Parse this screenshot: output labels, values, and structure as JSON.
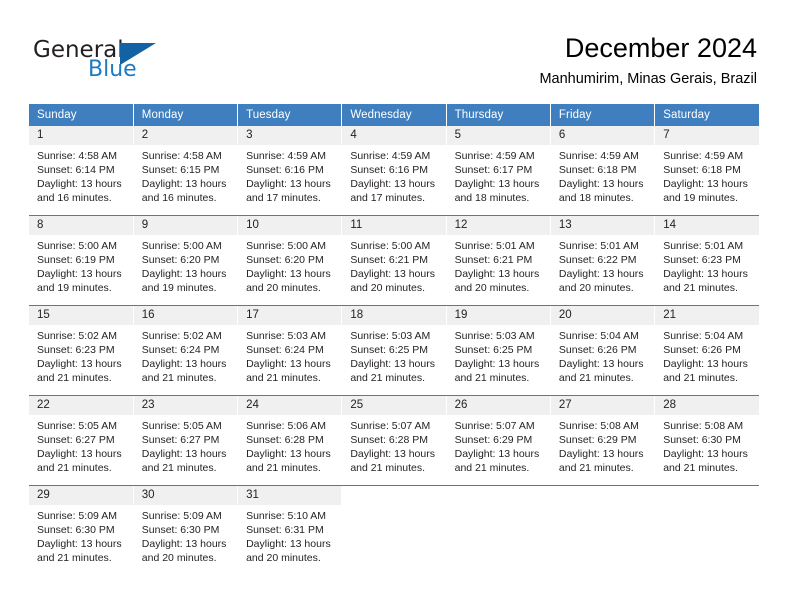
{
  "brand": {
    "name_part1": "General",
    "name_part2": "Blue",
    "triangle_color": "#1362a3",
    "blue_color": "#1f7ac1"
  },
  "header": {
    "title": "December 2024",
    "subtitle": "Manhumirim, Minas Gerais, Brazil"
  },
  "theme": {
    "header_blue": "#3f7fbf",
    "daynum_bg": "#f0f0f0"
  },
  "weekday_headers": [
    "Sunday",
    "Monday",
    "Tuesday",
    "Wednesday",
    "Thursday",
    "Friday",
    "Saturday"
  ],
  "weeks": [
    [
      {
        "day": "1",
        "sunrise": "Sunrise: 4:58 AM",
        "sunset": "Sunset: 6:14 PM",
        "daylight1": "Daylight: 13 hours",
        "daylight2": "and 16 minutes."
      },
      {
        "day": "2",
        "sunrise": "Sunrise: 4:58 AM",
        "sunset": "Sunset: 6:15 PM",
        "daylight1": "Daylight: 13 hours",
        "daylight2": "and 16 minutes."
      },
      {
        "day": "3",
        "sunrise": "Sunrise: 4:59 AM",
        "sunset": "Sunset: 6:16 PM",
        "daylight1": "Daylight: 13 hours",
        "daylight2": "and 17 minutes."
      },
      {
        "day": "4",
        "sunrise": "Sunrise: 4:59 AM",
        "sunset": "Sunset: 6:16 PM",
        "daylight1": "Daylight: 13 hours",
        "daylight2": "and 17 minutes."
      },
      {
        "day": "5",
        "sunrise": "Sunrise: 4:59 AM",
        "sunset": "Sunset: 6:17 PM",
        "daylight1": "Daylight: 13 hours",
        "daylight2": "and 18 minutes."
      },
      {
        "day": "6",
        "sunrise": "Sunrise: 4:59 AM",
        "sunset": "Sunset: 6:18 PM",
        "daylight1": "Daylight: 13 hours",
        "daylight2": "and 18 minutes."
      },
      {
        "day": "7",
        "sunrise": "Sunrise: 4:59 AM",
        "sunset": "Sunset: 6:18 PM",
        "daylight1": "Daylight: 13 hours",
        "daylight2": "and 19 minutes."
      }
    ],
    [
      {
        "day": "8",
        "sunrise": "Sunrise: 5:00 AM",
        "sunset": "Sunset: 6:19 PM",
        "daylight1": "Daylight: 13 hours",
        "daylight2": "and 19 minutes."
      },
      {
        "day": "9",
        "sunrise": "Sunrise: 5:00 AM",
        "sunset": "Sunset: 6:20 PM",
        "daylight1": "Daylight: 13 hours",
        "daylight2": "and 19 minutes."
      },
      {
        "day": "10",
        "sunrise": "Sunrise: 5:00 AM",
        "sunset": "Sunset: 6:20 PM",
        "daylight1": "Daylight: 13 hours",
        "daylight2": "and 20 minutes."
      },
      {
        "day": "11",
        "sunrise": "Sunrise: 5:00 AM",
        "sunset": "Sunset: 6:21 PM",
        "daylight1": "Daylight: 13 hours",
        "daylight2": "and 20 minutes."
      },
      {
        "day": "12",
        "sunrise": "Sunrise: 5:01 AM",
        "sunset": "Sunset: 6:21 PM",
        "daylight1": "Daylight: 13 hours",
        "daylight2": "and 20 minutes."
      },
      {
        "day": "13",
        "sunrise": "Sunrise: 5:01 AM",
        "sunset": "Sunset: 6:22 PM",
        "daylight1": "Daylight: 13 hours",
        "daylight2": "and 20 minutes."
      },
      {
        "day": "14",
        "sunrise": "Sunrise: 5:01 AM",
        "sunset": "Sunset: 6:23 PM",
        "daylight1": "Daylight: 13 hours",
        "daylight2": "and 21 minutes."
      }
    ],
    [
      {
        "day": "15",
        "sunrise": "Sunrise: 5:02 AM",
        "sunset": "Sunset: 6:23 PM",
        "daylight1": "Daylight: 13 hours",
        "daylight2": "and 21 minutes."
      },
      {
        "day": "16",
        "sunrise": "Sunrise: 5:02 AM",
        "sunset": "Sunset: 6:24 PM",
        "daylight1": "Daylight: 13 hours",
        "daylight2": "and 21 minutes."
      },
      {
        "day": "17",
        "sunrise": "Sunrise: 5:03 AM",
        "sunset": "Sunset: 6:24 PM",
        "daylight1": "Daylight: 13 hours",
        "daylight2": "and 21 minutes."
      },
      {
        "day": "18",
        "sunrise": "Sunrise: 5:03 AM",
        "sunset": "Sunset: 6:25 PM",
        "daylight1": "Daylight: 13 hours",
        "daylight2": "and 21 minutes."
      },
      {
        "day": "19",
        "sunrise": "Sunrise: 5:03 AM",
        "sunset": "Sunset: 6:25 PM",
        "daylight1": "Daylight: 13 hours",
        "daylight2": "and 21 minutes."
      },
      {
        "day": "20",
        "sunrise": "Sunrise: 5:04 AM",
        "sunset": "Sunset: 6:26 PM",
        "daylight1": "Daylight: 13 hours",
        "daylight2": "and 21 minutes."
      },
      {
        "day": "21",
        "sunrise": "Sunrise: 5:04 AM",
        "sunset": "Sunset: 6:26 PM",
        "daylight1": "Daylight: 13 hours",
        "daylight2": "and 21 minutes."
      }
    ],
    [
      {
        "day": "22",
        "sunrise": "Sunrise: 5:05 AM",
        "sunset": "Sunset: 6:27 PM",
        "daylight1": "Daylight: 13 hours",
        "daylight2": "and 21 minutes."
      },
      {
        "day": "23",
        "sunrise": "Sunrise: 5:05 AM",
        "sunset": "Sunset: 6:27 PM",
        "daylight1": "Daylight: 13 hours",
        "daylight2": "and 21 minutes."
      },
      {
        "day": "24",
        "sunrise": "Sunrise: 5:06 AM",
        "sunset": "Sunset: 6:28 PM",
        "daylight1": "Daylight: 13 hours",
        "daylight2": "and 21 minutes."
      },
      {
        "day": "25",
        "sunrise": "Sunrise: 5:07 AM",
        "sunset": "Sunset: 6:28 PM",
        "daylight1": "Daylight: 13 hours",
        "daylight2": "and 21 minutes."
      },
      {
        "day": "26",
        "sunrise": "Sunrise: 5:07 AM",
        "sunset": "Sunset: 6:29 PM",
        "daylight1": "Daylight: 13 hours",
        "daylight2": "and 21 minutes."
      },
      {
        "day": "27",
        "sunrise": "Sunrise: 5:08 AM",
        "sunset": "Sunset: 6:29 PM",
        "daylight1": "Daylight: 13 hours",
        "daylight2": "and 21 minutes."
      },
      {
        "day": "28",
        "sunrise": "Sunrise: 5:08 AM",
        "sunset": "Sunset: 6:30 PM",
        "daylight1": "Daylight: 13 hours",
        "daylight2": "and 21 minutes."
      }
    ],
    [
      {
        "day": "29",
        "sunrise": "Sunrise: 5:09 AM",
        "sunset": "Sunset: 6:30 PM",
        "daylight1": "Daylight: 13 hours",
        "daylight2": "and 21 minutes."
      },
      {
        "day": "30",
        "sunrise": "Sunrise: 5:09 AM",
        "sunset": "Sunset: 6:30 PM",
        "daylight1": "Daylight: 13 hours",
        "daylight2": "and 20 minutes."
      },
      {
        "day": "31",
        "sunrise": "Sunrise: 5:10 AM",
        "sunset": "Sunset: 6:31 PM",
        "daylight1": "Daylight: 13 hours",
        "daylight2": "and 20 minutes."
      },
      {
        "day": "",
        "sunrise": "",
        "sunset": "",
        "daylight1": "",
        "daylight2": ""
      },
      {
        "day": "",
        "sunrise": "",
        "sunset": "",
        "daylight1": "",
        "daylight2": ""
      },
      {
        "day": "",
        "sunrise": "",
        "sunset": "",
        "daylight1": "",
        "daylight2": ""
      },
      {
        "day": "",
        "sunrise": "",
        "sunset": "",
        "daylight1": "",
        "daylight2": ""
      }
    ]
  ]
}
